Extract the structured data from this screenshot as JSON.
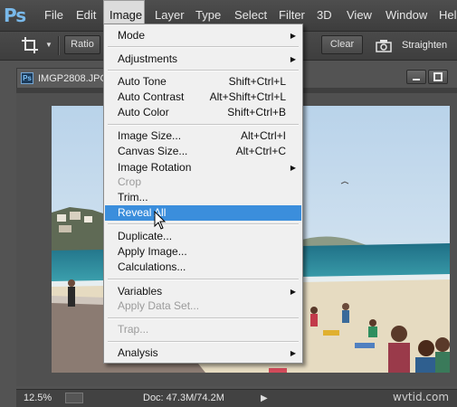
{
  "app": {
    "logo": "Ps"
  },
  "menubar": {
    "items": [
      "File",
      "Edit",
      "Image",
      "Layer",
      "Type",
      "Select",
      "Filter",
      "3D",
      "View",
      "Window",
      "Hel"
    ],
    "active": "Image"
  },
  "options_bar": {
    "tool_icon": "crop-icon",
    "ratio_label": "Ratio",
    "clear_label": "Clear",
    "straighten_label": "Straighten"
  },
  "document": {
    "tab_icon": "Ps",
    "title": "IMGP2808.JPG"
  },
  "image_menu": {
    "items": [
      {
        "label": "Mode",
        "submenu": true
      },
      {
        "label": "Adjustments",
        "submenu": true
      },
      {
        "label": "Auto Tone",
        "shortcut": "Shift+Ctrl+L"
      },
      {
        "label": "Auto Contrast",
        "shortcut": "Alt+Shift+Ctrl+L"
      },
      {
        "label": "Auto Color",
        "shortcut": "Shift+Ctrl+B"
      },
      {
        "label": "Image Size...",
        "shortcut": "Alt+Ctrl+I"
      },
      {
        "label": "Canvas Size...",
        "shortcut": "Alt+Ctrl+C"
      },
      {
        "label": "Image Rotation",
        "submenu": true
      },
      {
        "label": "Crop",
        "disabled": true
      },
      {
        "label": "Trim..."
      },
      {
        "label": "Reveal All",
        "highlighted": true
      },
      {
        "label": "Duplicate..."
      },
      {
        "label": "Apply Image..."
      },
      {
        "label": "Calculations..."
      },
      {
        "label": "Variables",
        "submenu": true
      },
      {
        "label": "Apply Data Set...",
        "disabled": true
      },
      {
        "label": "Trap...",
        "disabled": true
      },
      {
        "label": "Analysis",
        "submenu": true
      }
    ]
  },
  "status_bar": {
    "zoom": "12.5%",
    "doc_size": "Doc: 47.3M/74.2M"
  },
  "watermark": "wvtid.com",
  "colors": {
    "highlight": "#3b8edc",
    "ps_blue": "#79b9ea",
    "menu_bg": "#f0f0f0"
  }
}
